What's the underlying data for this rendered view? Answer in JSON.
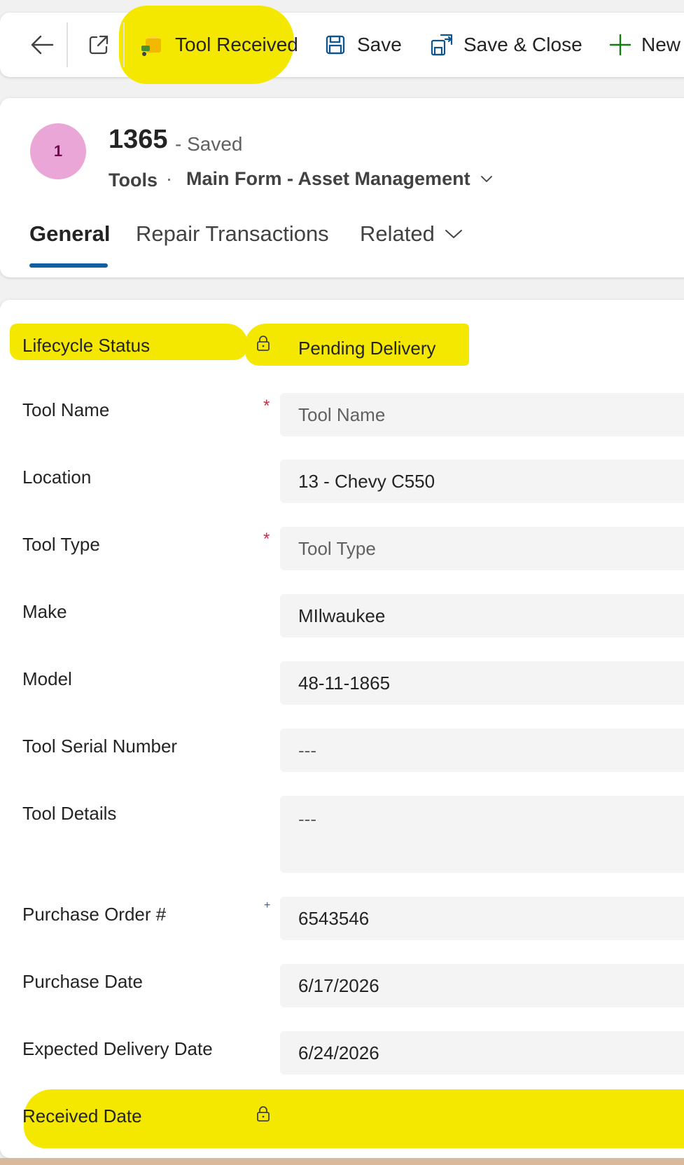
{
  "command_bar": {
    "back_label": "Back",
    "open_new_window_label": "Open in new window",
    "tool_received_label": "Tool Received",
    "save_label": "Save",
    "save_close_label": "Save & Close",
    "new_label": "New"
  },
  "header": {
    "avatar_initial": "1",
    "record_title": "1365",
    "save_status": "- Saved",
    "entity_name": "Tools",
    "separator": "·",
    "form_name": "Main Form - Asset Management"
  },
  "tabs": {
    "general": "General",
    "repair_transactions": "Repair Transactions",
    "related": "Related"
  },
  "fields": {
    "lifecycle_status": {
      "label": "Lifecycle Status",
      "value": "Pending Delivery",
      "locked": true
    },
    "tool_name": {
      "label": "Tool Name",
      "value": "",
      "placeholder": "Tool Name",
      "required_marker": "*"
    },
    "location": {
      "label": "Location",
      "value": "13 - Chevy C550"
    },
    "tool_type": {
      "label": "Tool Type",
      "value": "",
      "placeholder": "Tool Type",
      "required_marker": "*"
    },
    "make": {
      "label": "Make",
      "value": "MIlwaukee"
    },
    "model": {
      "label": "Model",
      "value": "48-11-1865"
    },
    "tool_serial_number": {
      "label": "Tool Serial Number",
      "value": "",
      "placeholder": "---"
    },
    "tool_details": {
      "label": "Tool Details",
      "value": "",
      "placeholder": "---"
    },
    "purchase_order": {
      "label": "Purchase Order #",
      "value": "6543546",
      "recommended_marker": "+"
    },
    "purchase_date": {
      "label": "Purchase Date",
      "value": "6/17/2026"
    },
    "expected_delivery_date": {
      "label": "Expected Delivery Date",
      "value": "6/24/2026"
    },
    "received_date": {
      "label": "Received Date",
      "value": "",
      "locked": true
    }
  },
  "colors": {
    "highlight": "#f5e800",
    "accent": "#115ea3",
    "required": "#c4314b",
    "avatar": "#e9a6d6",
    "new_icon": "#107c10",
    "tool_received_icon": "#e8b400"
  }
}
